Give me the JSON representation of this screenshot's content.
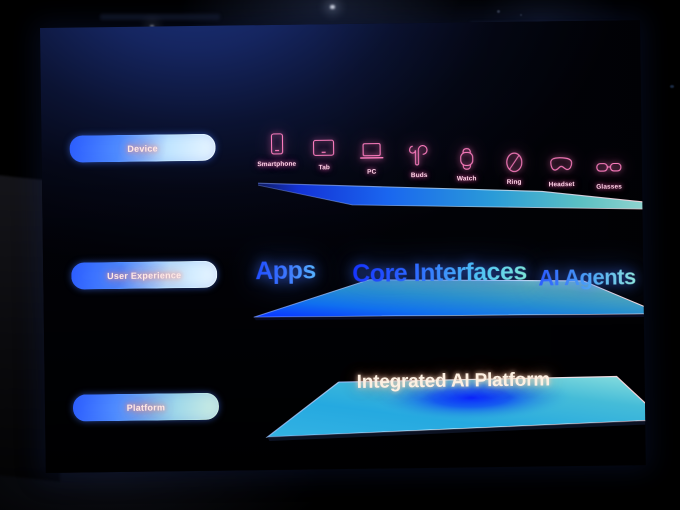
{
  "scene": {
    "venue_description": "dark auditorium with tilted LED presentation wall",
    "screen_background_top": "#1c3480",
    "screen_background_bottom": "#010208"
  },
  "slide": {
    "title": "Integrated AI Platform",
    "accent_pill_border_start": "#2b5cff",
    "accent_pill_border_end": "#eaf6ff",
    "pill_text_color": "#ffe9e6",
    "device_icon_color": "#ff79bd",
    "ux_text_gradient_start": "#1e4bff",
    "ux_text_gradient_end": "#8fe8df",
    "platform_title_color": "#fdf0e2"
  },
  "rows": {
    "device": {
      "pill_label": "Device",
      "items": [
        {
          "label": "Smartphone",
          "icon": "smartphone-icon"
        },
        {
          "label": "Tab",
          "icon": "tablet-icon"
        },
        {
          "label": "PC",
          "icon": "laptop-icon"
        },
        {
          "label": "Buds",
          "icon": "earbuds-icon"
        },
        {
          "label": "Watch",
          "icon": "smartwatch-icon"
        },
        {
          "label": "Ring",
          "icon": "smart-ring-icon"
        },
        {
          "label": "Headset",
          "icon": "xr-headset-icon"
        },
        {
          "label": "Glasses",
          "icon": "smart-glasses-icon"
        }
      ]
    },
    "user_experience": {
      "pill_label": "User Experience",
      "words": [
        "Apps",
        "Core Interfaces",
        "AI Agents"
      ]
    },
    "platform": {
      "pill_label": "Platform",
      "headline": "Integrated AI Platform"
    }
  },
  "layers": [
    {
      "name": "device-layer-slab",
      "tint_left": "#1a43ff",
      "tint_right": "#7fd4d2"
    },
    {
      "name": "experience-layer-slab",
      "tint_left": "#0d5bff",
      "tint_right": "#9fe0dc"
    },
    {
      "name": "platform-layer-slab",
      "tint_left": "#37b6e8",
      "tint_center": "#0a35ff",
      "tint_right": "#86e2e0"
    }
  ]
}
